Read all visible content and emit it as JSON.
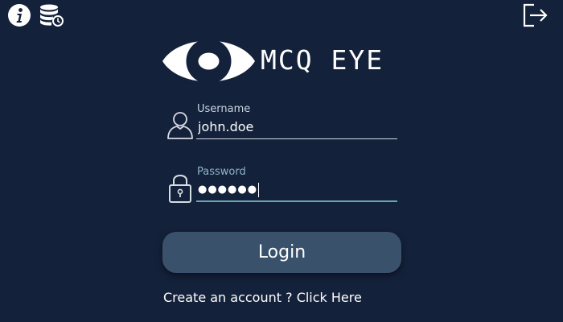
{
  "app": {
    "name": "MCQ EYE"
  },
  "toolbar": {
    "info_icon": "info-icon",
    "database_restore_icon": "database-restore-icon",
    "exit_icon": "exit-icon"
  },
  "login_form": {
    "username": {
      "label": "Username",
      "value": "john.doe",
      "icon": "user-icon"
    },
    "password": {
      "label": "Password",
      "masked_value": "●●●●●●",
      "icon": "lock-icon"
    },
    "login_button": "Login",
    "create_account_link": "Create an account ? Click Here"
  },
  "colors": {
    "background": "#14213a",
    "button": "#3a516c",
    "focused_underline": "#6aa4b0",
    "focused_label": "#8fb3c4",
    "label": "#c9d3de",
    "text": "#ffffff"
  }
}
